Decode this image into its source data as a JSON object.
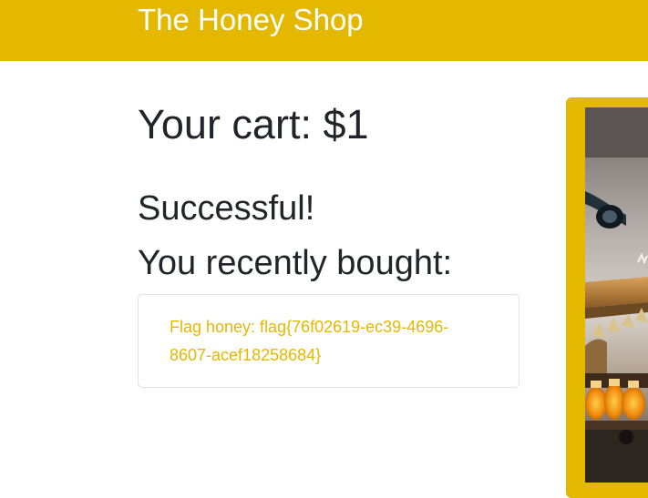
{
  "header": {
    "brand": "The Honey Shop"
  },
  "cart": {
    "title": "Your cart: $1"
  },
  "status": {
    "message": "Successful!",
    "recent_heading": "You recently bought:"
  },
  "purchase": {
    "item_text": "Flag honey: flag{76f02619-ec39-4696-8607-acef18258684}"
  },
  "colors": {
    "brand": "#e5b800",
    "text": "#212529",
    "card_border": "#dfe2e6"
  },
  "image": {
    "icon": "honey-shop-photo"
  }
}
